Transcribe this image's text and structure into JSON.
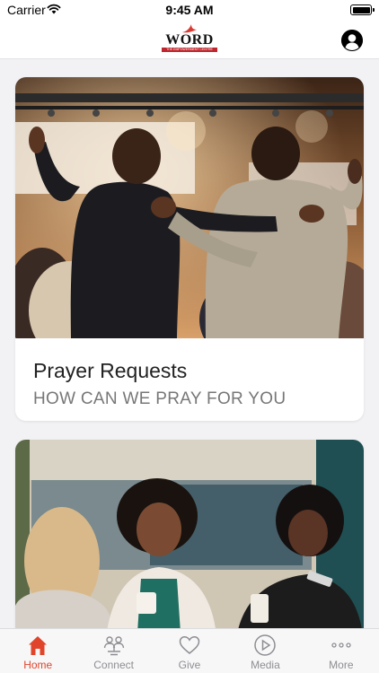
{
  "status_bar": {
    "carrier": "Carrier",
    "time": "9:45 AM"
  },
  "header": {
    "logo_text": "WORD",
    "logo_tagline": "THE EMPOWERMENT CENTRE",
    "profile_icon": "person-circle-icon"
  },
  "cards": [
    {
      "title": "Prayer Requests",
      "subtitle": "HOW CAN WE PRAY FOR YOU",
      "image": "worship-photo"
    },
    {
      "title": "",
      "subtitle": "",
      "image": "fellowship-photo"
    }
  ],
  "tab_bar": {
    "active_color": "#e0452b",
    "inactive_color": "#8e8e93",
    "items": [
      {
        "label": "Home",
        "icon": "home-icon",
        "active": true
      },
      {
        "label": "Connect",
        "icon": "connect-icon",
        "active": false
      },
      {
        "label": "Give",
        "icon": "heart-icon",
        "active": false
      },
      {
        "label": "Media",
        "icon": "play-icon",
        "active": false
      },
      {
        "label": "More",
        "icon": "more-icon",
        "active": false
      }
    ]
  }
}
